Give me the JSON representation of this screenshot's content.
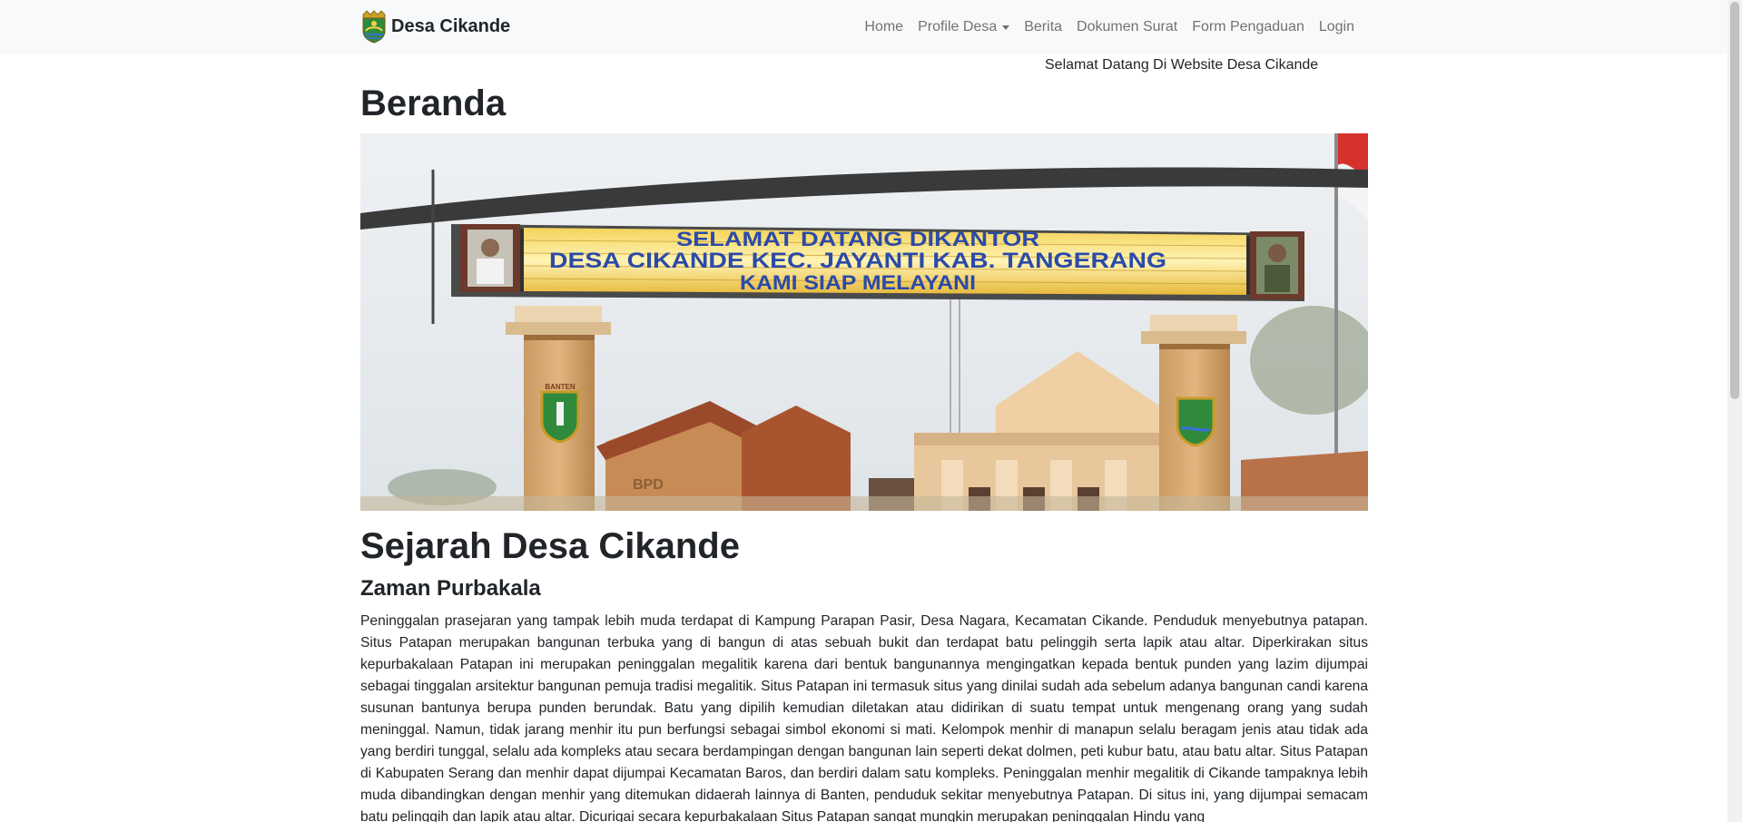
{
  "brand": {
    "name": "Desa Cikande",
    "logo_icon": "kabupaten-tangerang-emblem-icon"
  },
  "nav": {
    "items": [
      {
        "label": "Home"
      },
      {
        "label": "Profile Desa",
        "has_dropdown": true
      },
      {
        "label": "Berita"
      },
      {
        "label": "Dokumen Surat"
      },
      {
        "label": "Form Pengaduan"
      },
      {
        "label": "Login"
      }
    ]
  },
  "welcome_text": "Selamat Datang Di Website Desa Cikande",
  "page_title": "Beranda",
  "hero": {
    "sign_lines": [
      "SELAMAT DATANG DIKANTOR",
      "DESA CIKANDE KEC. JAYANTI KAB. TANGERANG",
      "KAMI SIAP MELAYANI"
    ],
    "left_pillar_label": "BANTEN",
    "building_label": "BPD"
  },
  "history": {
    "title": "Sejarah Desa Cikande",
    "subtitle": "Zaman Purbakala",
    "paragraph": "Peninggalan prasejaran yang tampak lebih muda terdapat di Kampung Parapan Pasir, Desa Nagara, Kecamatan Cikande. Penduduk menyebutnya patapan. Situs Patapan merupakan bangunan terbuka yang di bangun di atas sebuah bukit dan terdapat batu pelinggih serta lapik atau altar. Diperkirakan situs kepurbakalaan Patapan ini merupakan peninggalan megalitik karena dari bentuk bangunannya mengingatkan kepada bentuk punden yang lazim dijumpai sebagai tinggalan arsitektur bangunan pemuja tradisi megalitik. Situs Patapan ini termasuk situs yang dinilai sudah ada sebelum adanya bangunan candi karena susunan bantunya berupa punden berundak. Batu yang dipilih kemudian diletakan atau didirikan di suatu tempat untuk mengenang orang yang sudah meninggal. Namun, tidak jarang menhir itu pun berfungsi sebagai simbol ekonomi si mati. Kelompok menhir di manapun selalu beragam jenis atau tidak ada yang berdiri tunggal, selalu ada kompleks atau secara berdampingan dengan bangunan lain seperti dekat dolmen, peti kubur batu, atau batu altar. Situs Patapan di Kabupaten Serang dan menhir dapat dijumpai Kecamatan Baros, dan berdiri dalam satu kompleks. Peninggalan menhir megalitik di Cikande tampaknya lebih muda dibandingkan dengan menhir yang ditemukan didaerah lainnya di Banten, penduduk sekitar menyebutnya Patapan. Di situs ini, yang dijumpai semacam batu pelinggih dan lapik atau altar. Dicurigai secara kepurbakalaan Situs Patapan sangat mungkin merupakan peninggalan Hindu yang"
  },
  "colors": {
    "navbar_bg": "#f8f9fa",
    "nav_link": "rgba(0,0,0,0.55)",
    "text": "#212529"
  }
}
